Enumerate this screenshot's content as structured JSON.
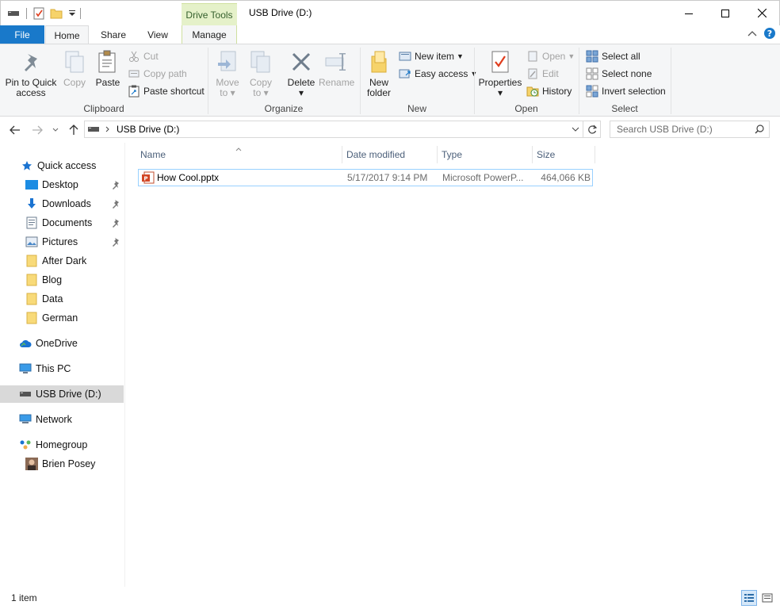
{
  "window": {
    "title": "USB Drive (D:)",
    "contextual_tab_group": "Drive Tools"
  },
  "tabs": {
    "file": "File",
    "home": "Home",
    "share": "Share",
    "view": "View",
    "manage": "Manage"
  },
  "ribbon": {
    "clipboard": {
      "label": "Clipboard",
      "pin_line1": "Pin to Quick",
      "pin_line2": "access",
      "copy": "Copy",
      "paste": "Paste",
      "cut": "Cut",
      "copy_path": "Copy path",
      "paste_shortcut": "Paste shortcut"
    },
    "organize": {
      "label": "Organize",
      "move_line1": "Move",
      "move_line2": "to",
      "copy_line1": "Copy",
      "copy_line2": "to",
      "delete": "Delete",
      "rename": "Rename"
    },
    "new": {
      "label": "New",
      "new_folder_line1": "New",
      "new_folder_line2": "folder",
      "new_item": "New item",
      "easy_access": "Easy access"
    },
    "open": {
      "label": "Open",
      "properties": "Properties",
      "open": "Open",
      "edit": "Edit",
      "history": "History"
    },
    "select": {
      "label": "Select",
      "select_all": "Select all",
      "select_none": "Select none",
      "invert_selection": "Invert selection"
    }
  },
  "address": {
    "path": "USB Drive (D:)",
    "search_placeholder": "Search USB Drive (D:)"
  },
  "nav": {
    "quick_access": "Quick access",
    "desktop": "Desktop",
    "downloads": "Downloads",
    "documents": "Documents",
    "pictures": "Pictures",
    "after_dark": "After Dark",
    "blog": "Blog",
    "data": "Data",
    "german": "German",
    "onedrive": "OneDrive",
    "this_pc": "This PC",
    "usb_drive": "USB Drive (D:)",
    "network": "Network",
    "homegroup": "Homegroup",
    "brien_posey": "Brien Posey"
  },
  "columns": {
    "name": "Name",
    "date_modified": "Date modified",
    "type": "Type",
    "size": "Size"
  },
  "files": [
    {
      "name": "How Cool.pptx",
      "date_modified": "5/17/2017 9:14 PM",
      "type": "Microsoft PowerP...",
      "size": "464,066 KB"
    }
  ],
  "status": {
    "item_count": "1 item"
  },
  "colors": {
    "accent": "#1979ca",
    "drive_tools_bg": "#e5f1c9",
    "selection_border": "#99d1ff",
    "nav_selected": "#d9d9d9"
  }
}
